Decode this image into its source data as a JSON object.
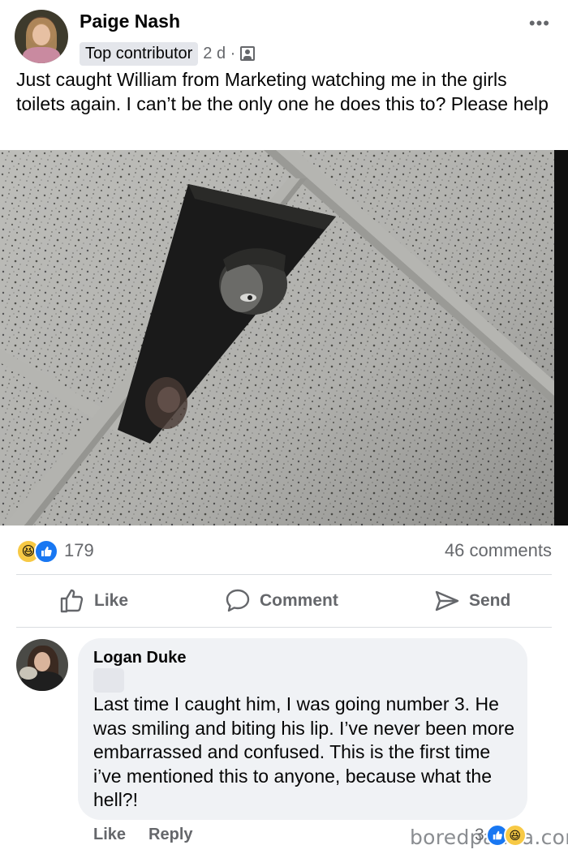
{
  "post": {
    "author": "Paige Nash",
    "badge": "Top contributor",
    "time": "2 d ·",
    "audience_icon": "people-audience-icon",
    "more_icon": "•••",
    "text": "Just caught William from Marketing watching me in the girls toilets again. I can’t be the only one he does this to? Please help"
  },
  "reactions": {
    "icons": [
      "haha-emoji-icon",
      "like-reaction-icon"
    ],
    "count": "179",
    "comments": "46 comments"
  },
  "actions": {
    "like": "Like",
    "comment": "Comment",
    "send": "Send"
  },
  "comment": {
    "author": "Logan Duke",
    "text": "Last time I caught him, I was going number 3. He was smiling and biting his lip. I’ve never been more embarrassed and confused. This is the first time i’ve mentioned this to anyone, because what the hell?!",
    "like": "Like",
    "reply": "Reply",
    "reaction_count": "3"
  },
  "watermark": "boredpanda.com",
  "colors": {
    "like_blue": "#1877f2",
    "meta_gray": "#65676b",
    "bubble_bg": "#f0f2f5",
    "haha_yellow": "#f7c945"
  }
}
